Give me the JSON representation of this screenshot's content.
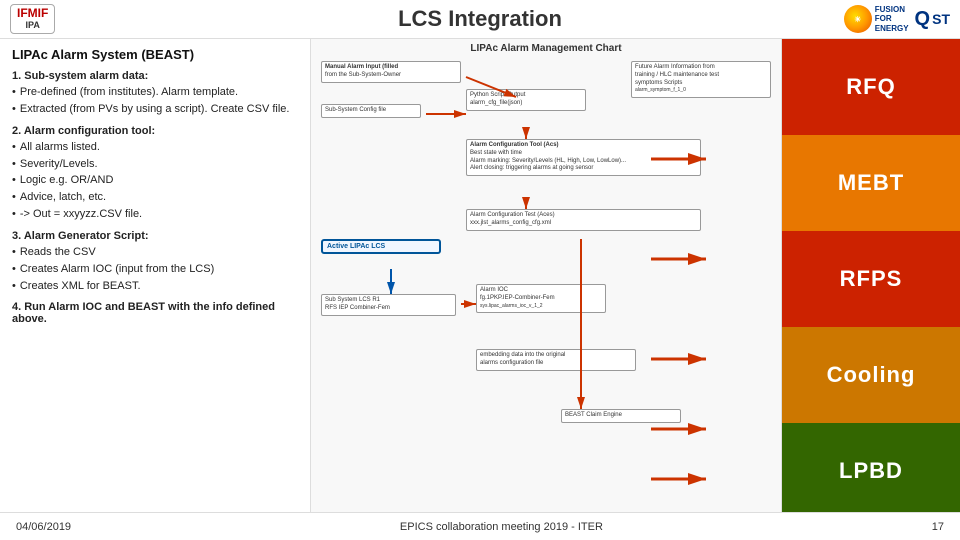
{
  "header": {
    "title": "LCS Integration",
    "logo_left_name": "IFMIF",
    "logo_left_sub": "IPA",
    "logo_right_fusion": "FUSION\nFOR\nENERGY",
    "logo_right_qst": "QST"
  },
  "left_panel": {
    "section_title": "LIPAc Alarm System (BEAST)",
    "section1_title": "1. Sub-system alarm data:",
    "section1_bullets": [
      "Pre-defined  (from   institutes). Alarm template.",
      "Extracted (from PVs by using a script). Create CSV file."
    ],
    "section2_title": "2. Alarm configuration tool:",
    "section2_bullets": [
      "All alarms listed.",
      "Severity/Levels.",
      "Logic e.g. OR/AND",
      "Advice, latch, etc.",
      "-> Out = xxyyzz.CSV file."
    ],
    "section3_title": "3. Alarm Generator Script:",
    "section3_bullets": [
      "Reads the CSV",
      "Creates Alarm IOC (input from the LCS)",
      "Creates XML for BEAST."
    ],
    "section4_title": "4. Run Alarm IOC and BEAST with the info defined above."
  },
  "center": {
    "diagram_title": "LIPAc Alarm Management Chart",
    "boxes": [
      {
        "label": "Manual Alarm Input (filled\nfrom the Sub-System-Owner",
        "type": "blue"
      },
      {
        "label": "Sub-System Config file",
        "type": "white"
      },
      {
        "label": "Python Script Output\nalarm_cfg_file(json)",
        "type": "white"
      },
      {
        "label": "Alarm Configuration Tool (Acs)\nBest state with time\nAlarm marking: Severity/Levels...\nAlert closing: triggering alarms at going sensor",
        "type": "white"
      },
      {
        "label": "Alarm Configuration Test (Aces)\nxxx.jlst_alarms_config_cfg.xml",
        "type": "gray"
      },
      {
        "label": "Active LIPAc LCS",
        "type": "active"
      },
      {
        "label": "Sub-System LCS R1\nRFS IEP Combiner-Fem",
        "type": "white"
      },
      {
        "label": "Alarm IOC\nfg.1PKP.IEP-Combiner-Fem",
        "type": "white"
      },
      {
        "label": "sys.lipac_alarms_ioc_v_1_2",
        "type": "white"
      },
      {
        "label": "embedding data into the original\nalarms configuration file",
        "type": "white"
      },
      {
        "label": "BEAST Claim Engine",
        "type": "white"
      }
    ]
  },
  "right_panel": {
    "blocks": [
      {
        "label": "RFQ",
        "class": "block-rfq"
      },
      {
        "label": "MEBT",
        "class": "block-mebt"
      },
      {
        "label": "RFPS",
        "class": "block-rfps"
      },
      {
        "label": "Cooling",
        "class": "block-cooling"
      },
      {
        "label": "LPBD",
        "class": "block-lpbd"
      }
    ]
  },
  "footer": {
    "date": "04/06/2019",
    "event": "EPICS collaboration meeting 2019 - ITER",
    "page": "17"
  }
}
